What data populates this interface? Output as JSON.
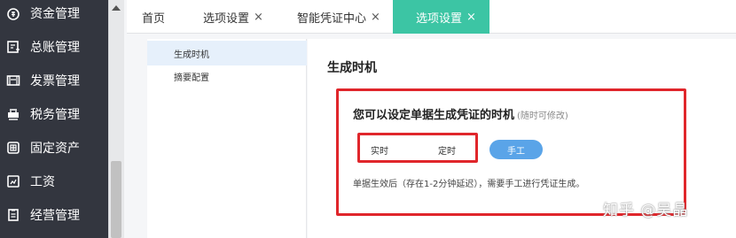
{
  "sidebar": {
    "items": [
      {
        "label": "资金管理",
        "icon": "money-bag-icon"
      },
      {
        "label": "总账管理",
        "icon": "ledger-icon"
      },
      {
        "label": "发票管理",
        "icon": "invoice-icon"
      },
      {
        "label": "税务管理",
        "icon": "tax-icon"
      },
      {
        "label": "固定资产",
        "icon": "asset-icon"
      },
      {
        "label": "工资",
        "icon": "salary-icon"
      },
      {
        "label": "经营管理",
        "icon": "report-icon"
      }
    ]
  },
  "tabs": [
    {
      "label": "首页",
      "closable": false
    },
    {
      "label": "选项设置",
      "closable": true,
      "close": "×"
    },
    {
      "label": "智能凭证中心",
      "closable": true,
      "close": "×"
    },
    {
      "label": "选项设置",
      "closable": true,
      "close": "×",
      "active": true
    }
  ],
  "submenu": {
    "items": [
      {
        "label": "生成时机",
        "active": true
      },
      {
        "label": "摘要配置",
        "active": false
      }
    ]
  },
  "content": {
    "title": "生成时机",
    "heading": "您可以设定单据生成凭证的时机",
    "heading_hint": "(随时可修改)",
    "options": {
      "realtime": "实时",
      "scheduled": "定时",
      "manual": "手工"
    },
    "description": "单据生效后（存在1-2分钟延迟），需要手工进行凭证生成。"
  },
  "watermark": "知乎 @吴晶",
  "colors": {
    "sidebar_bg": "#33363f",
    "active_tab": "#3cc5a4",
    "manual_button": "#5aa4e8",
    "highlight_box": "#e0262b",
    "submenu_active": "#e6f0fb"
  }
}
